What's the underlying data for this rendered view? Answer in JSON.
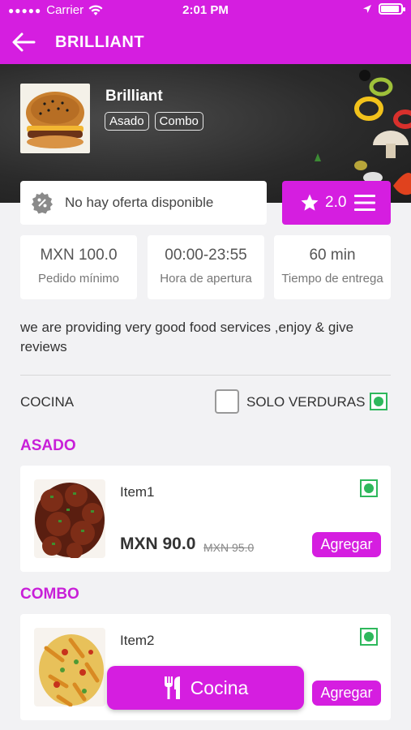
{
  "status_bar": {
    "carrier": "Carrier",
    "time": "2:01 PM",
    "battery_level": 0.9
  },
  "header": {
    "title": "BRILLIANT"
  },
  "restaurant": {
    "name": "Brilliant",
    "tags": [
      "Asado",
      "Combo"
    ],
    "offer_text": "No hay oferta disponible",
    "rating": "2.0"
  },
  "info_cards": [
    {
      "value": "MXN 100.0",
      "label": "Pedido mínimo"
    },
    {
      "value": "00:00-23:55",
      "label": "Hora de apertura"
    },
    {
      "value": "60 min",
      "label": "Tiempo de entrega"
    }
  ],
  "description": "we are providing very  good food services ,enjoy & give reviews",
  "filter": {
    "cuisine_label": "COCINA",
    "veg_only_label": "SOLO VERDURAS",
    "veg_only_checked": false
  },
  "sections": [
    {
      "title": "ASADO",
      "items": [
        {
          "name": "Item1",
          "price": "MXN 90.0",
          "old_price": "MXN 95.0",
          "add_label": "Agregar"
        }
      ]
    },
    {
      "title": "COMBO",
      "items": [
        {
          "name": "Item2",
          "add_label": "Agregar"
        }
      ]
    }
  ],
  "floating_button": {
    "label": "Cocina",
    "icon": "fork-knife-icon"
  },
  "colors": {
    "primary": "#d51ee0",
    "veg_green": "#2eb85c"
  },
  "icons": {
    "back": "back-arrow-icon",
    "wifi": "wifi-icon",
    "location": "location-arrow-icon",
    "offer": "percent-badge-icon",
    "star": "star-icon",
    "menu": "hamburger-menu-icon"
  }
}
